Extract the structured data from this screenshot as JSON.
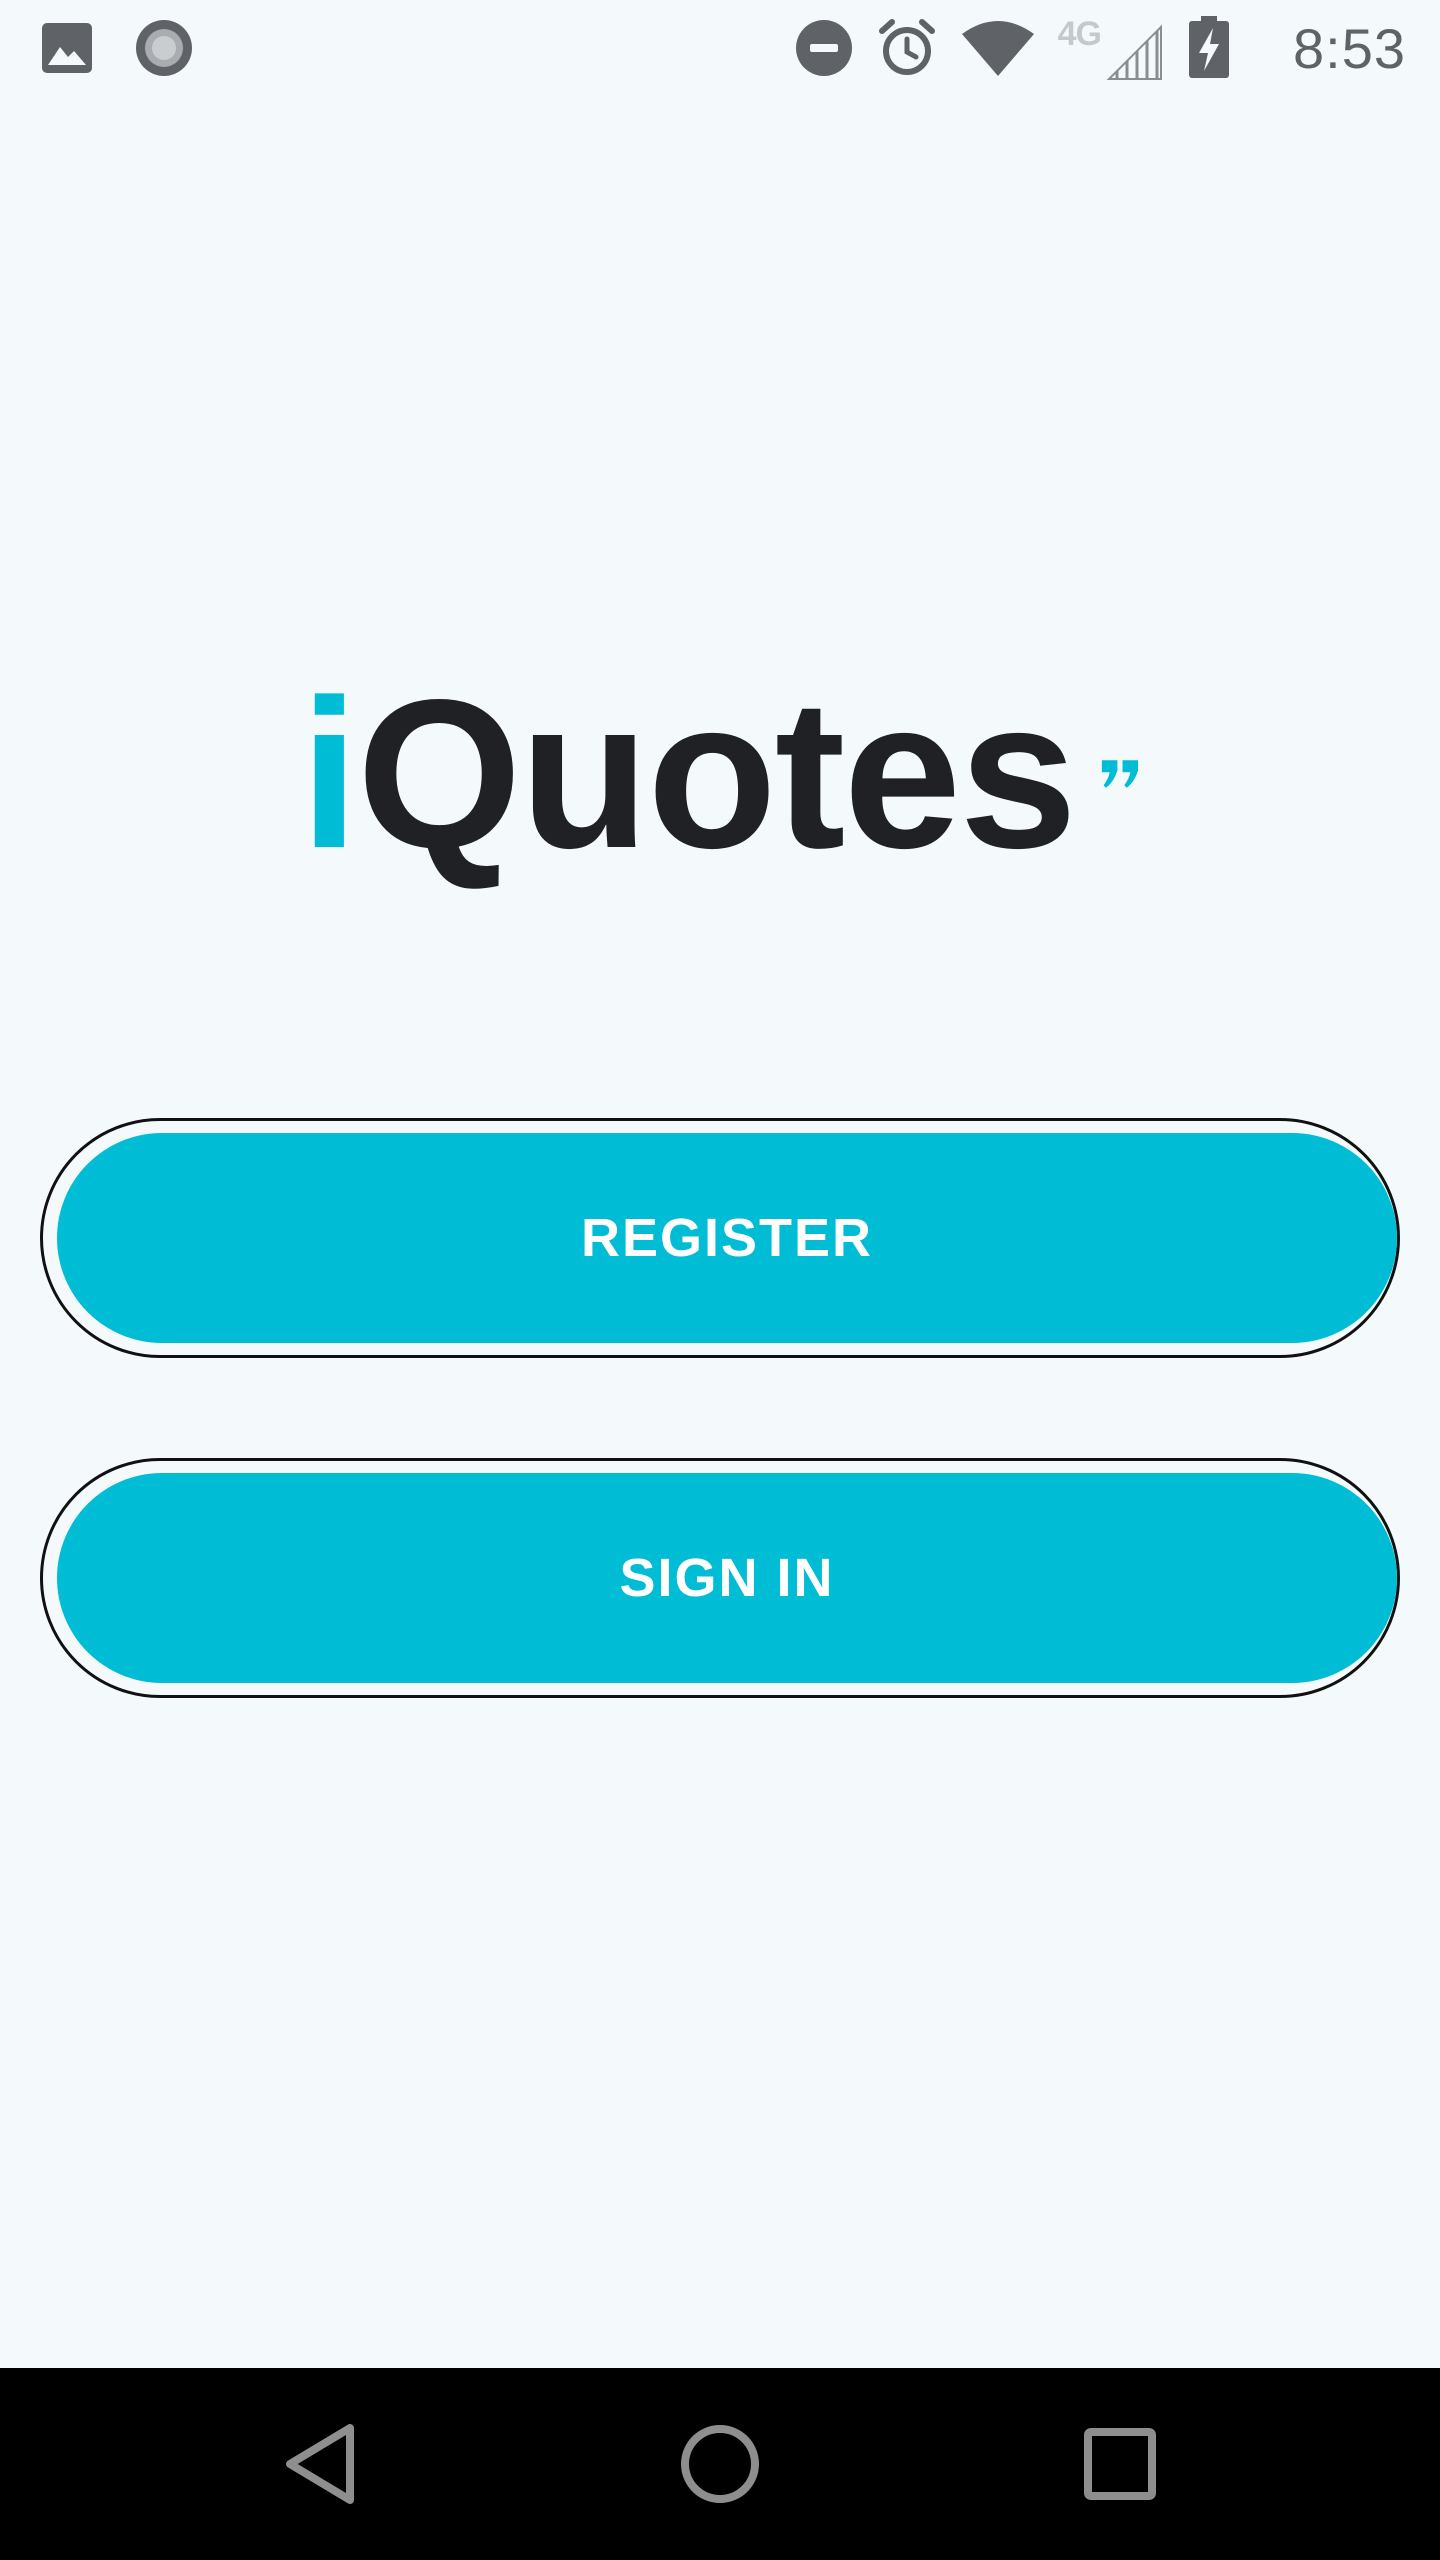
{
  "status_bar": {
    "time": "8:53",
    "network_label": "4G",
    "icons": {
      "left": [
        "gallery-notification-icon",
        "record-notification-icon"
      ],
      "right": [
        "do-not-disturb-icon",
        "alarm-icon",
        "wifi-icon",
        "cellular-signal-icon",
        "battery-charging-icon"
      ]
    }
  },
  "logo": {
    "prefix": "i",
    "name": "Quotes",
    "quote_mark": "”"
  },
  "buttons": {
    "register_label": "REGISTER",
    "signin_label": "SIGN IN"
  },
  "navigation": {
    "icons": [
      "back-icon",
      "home-icon",
      "recents-icon"
    ]
  },
  "colors": {
    "accent": "#00bcd4",
    "background": "#f4f9fc",
    "text_dark": "#202124",
    "status_icon": "#5f6368",
    "nav_bar": "#000000"
  }
}
